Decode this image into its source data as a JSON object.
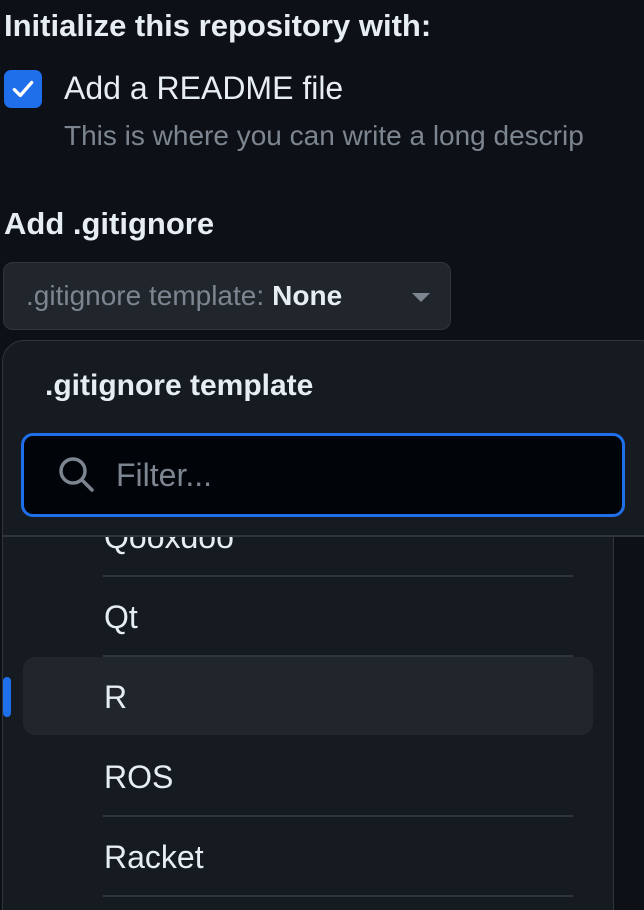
{
  "initialize": {
    "heading": "Initialize this repository with:",
    "readme": {
      "label": "Add a README file",
      "checked": true,
      "description": "This is where you can write a long descrip"
    }
  },
  "gitignore": {
    "heading": "Add .gitignore",
    "button": {
      "prefix": ".gitignore template:",
      "value": "None"
    },
    "dropdown": {
      "title": ".gitignore template",
      "filter_placeholder": "Filter...",
      "items": [
        {
          "label": "Qooxdoo"
        },
        {
          "label": "Qt"
        },
        {
          "label": "R",
          "selected": true
        },
        {
          "label": "ROS"
        },
        {
          "label": "Racket"
        }
      ]
    }
  },
  "colors": {
    "accent": "#1f6feb",
    "background": "#0d1117",
    "surface": "#161b22",
    "border": "#30363d",
    "muted_text": "#7d8590"
  },
  "icons": {
    "checkbox": "check-icon",
    "filter": "search-icon",
    "button_caret": "triangle-down-icon"
  }
}
